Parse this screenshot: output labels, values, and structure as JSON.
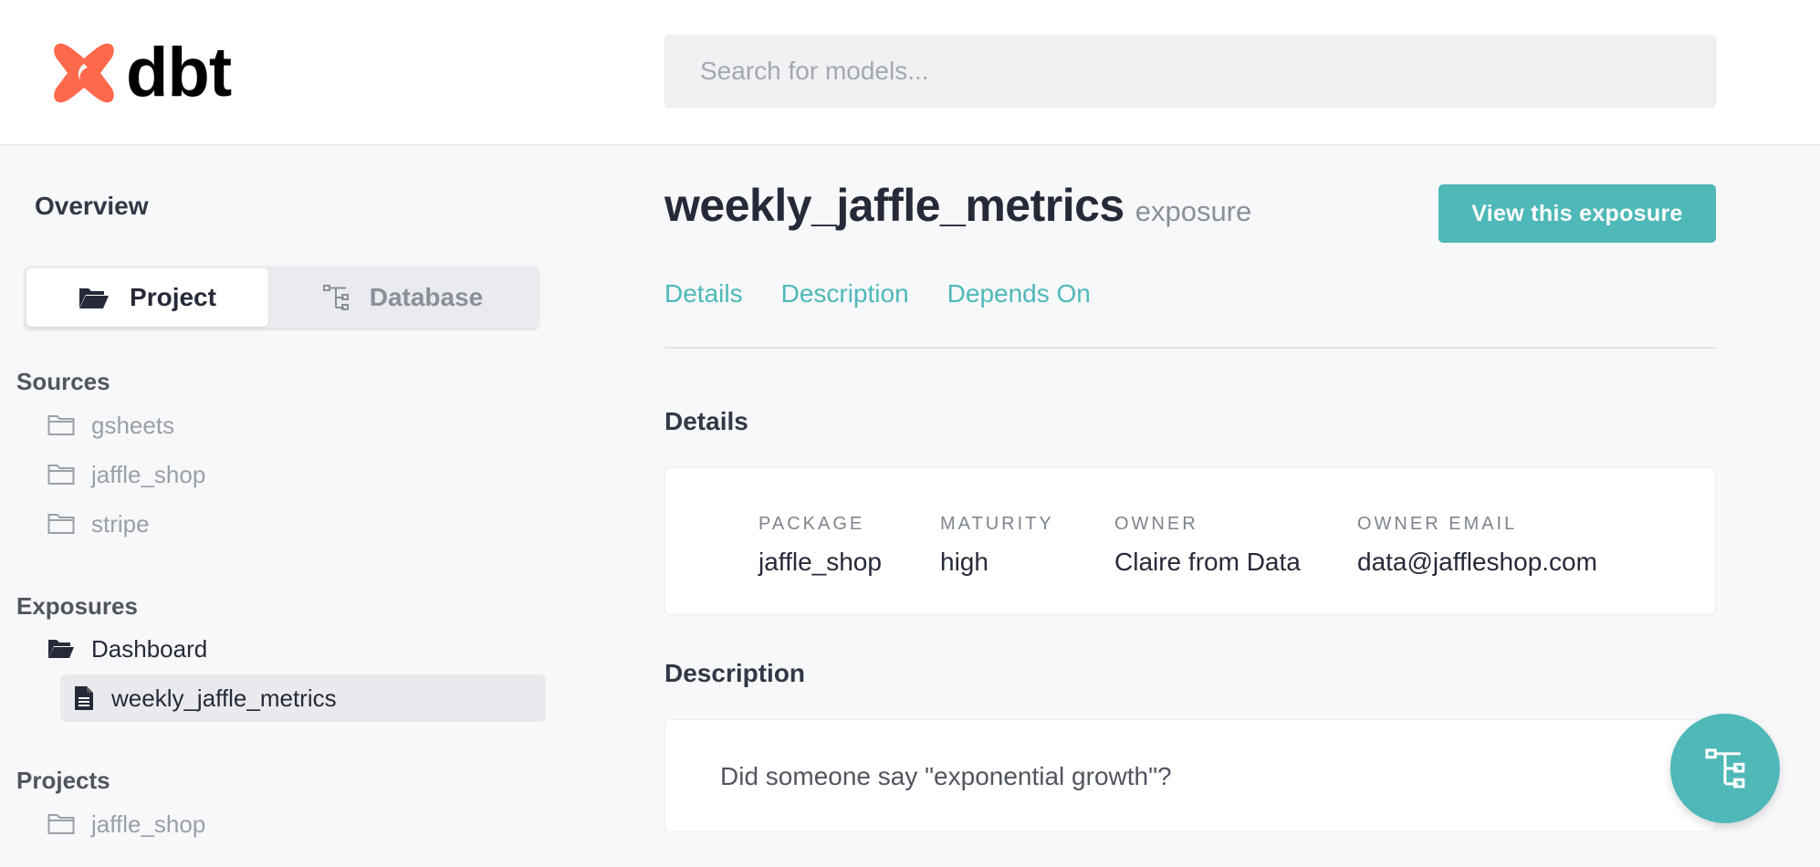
{
  "app": {
    "logo_text": "dbt",
    "brand_color": "#ff694b",
    "accent_color": "#4fb8b8"
  },
  "search": {
    "placeholder": "Search for models..."
  },
  "sidebar": {
    "overview_label": "Overview",
    "toggle": {
      "project_label": "Project",
      "database_label": "Database",
      "active": "Project"
    },
    "sources": {
      "title": "Sources",
      "items": [
        "gsheets",
        "jaffle_shop",
        "stripe"
      ]
    },
    "exposures": {
      "title": "Exposures",
      "folder": "Dashboard",
      "items": [
        "weekly_jaffle_metrics"
      ]
    },
    "projects": {
      "title": "Projects",
      "items": [
        "jaffle_shop"
      ]
    }
  },
  "main": {
    "title": "weekly_jaffle_metrics",
    "resource_type": "exposure",
    "view_button_label": "View this exposure",
    "tabs": [
      "Details",
      "Description",
      "Depends On"
    ],
    "details": {
      "heading": "Details",
      "fields": [
        {
          "label": "PACKAGE",
          "value": "jaffle_shop"
        },
        {
          "label": "MATURITY",
          "value": "high"
        },
        {
          "label": "OWNER",
          "value": "Claire from Data"
        },
        {
          "label": "OWNER EMAIL",
          "value": "data@jaffleshop.com"
        }
      ]
    },
    "description": {
      "heading": "Description",
      "text": "Did someone say \"exponential growth\"?"
    }
  },
  "icons": {
    "folder": "folder-icon",
    "folder_open": "folder-open-icon",
    "file": "file-text-icon",
    "lineage": "lineage-graph-icon"
  }
}
